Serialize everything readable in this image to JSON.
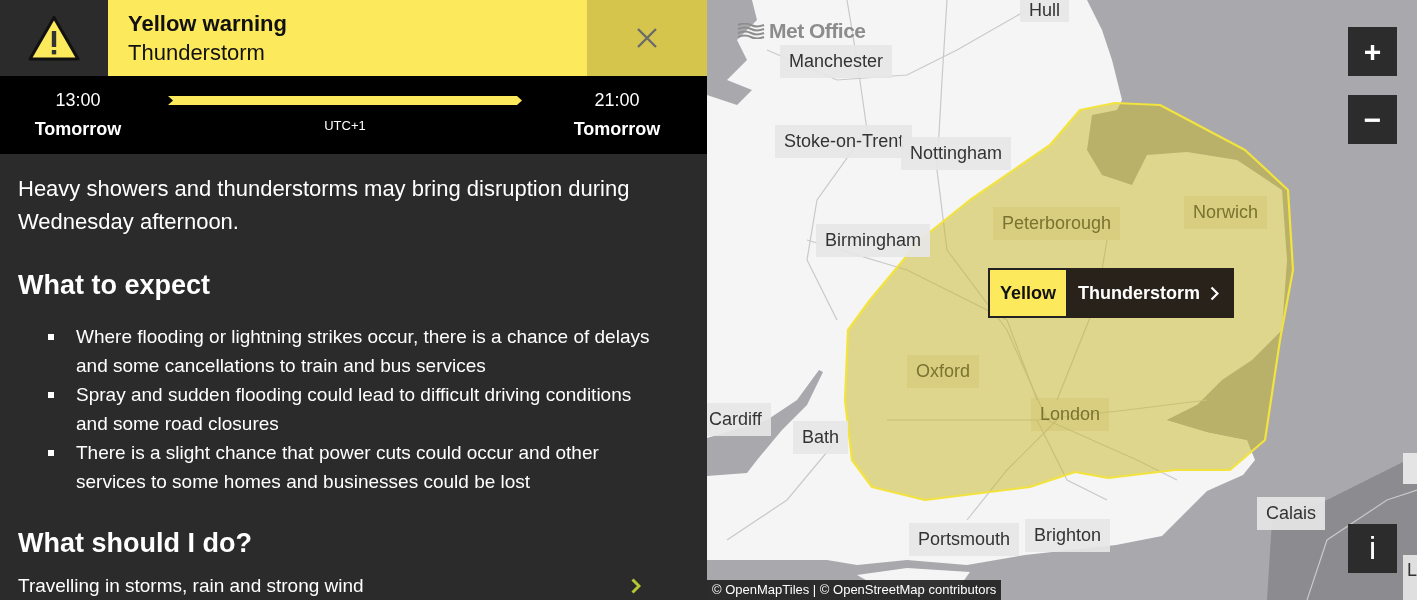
{
  "warning": {
    "title": "Yellow warning",
    "subtitle": "Thunderstorm"
  },
  "timeline": {
    "start_time": "13:00",
    "start_day": "Tomorrow",
    "timezone": "UTC+1",
    "end_time": "21:00",
    "end_day": "Tomorrow"
  },
  "summary": "Heavy showers and thunderstorms may bring disruption during Wednesday afternoon.",
  "what_to_expect": {
    "heading": "What to expect",
    "bullets": [
      "Where flooding or lightning strikes occur, there is a chance of delays and some cancellations to train and bus services",
      "Spray and sudden flooding could lead to difficult driving conditions and some road closures",
      "There is a slight chance that power cuts could occur and other services to some homes and businesses could be lost"
    ]
  },
  "what_to_do": {
    "heading": "What should I do?",
    "links": [
      "Travelling in storms, rain and strong wind"
    ]
  },
  "map": {
    "logo": "Met Office",
    "places": [
      {
        "name": "Hull",
        "inside_warning": false
      },
      {
        "name": "Manchester",
        "inside_warning": false
      },
      {
        "name": "Stoke-on-Trent",
        "inside_warning": false
      },
      {
        "name": "Nottingham",
        "inside_warning": false
      },
      {
        "name": "Norwich",
        "inside_warning": true
      },
      {
        "name": "Peterborough",
        "inside_warning": true
      },
      {
        "name": "Birmingham",
        "inside_warning": false
      },
      {
        "name": "Oxford",
        "inside_warning": true
      },
      {
        "name": "London",
        "inside_warning": true
      },
      {
        "name": "Cardiff",
        "inside_warning": false
      },
      {
        "name": "Bath",
        "inside_warning": false
      },
      {
        "name": "Calais",
        "inside_warning": false
      },
      {
        "name": "Brighton",
        "inside_warning": false
      },
      {
        "name": "Portsmouth",
        "inside_warning": false
      },
      {
        "name": "L",
        "inside_warning": false
      }
    ],
    "warning_chip": {
      "severity": "Yellow",
      "label": "Thunderstorm"
    },
    "zoom_in": "+",
    "zoom_out": "−",
    "info": "i",
    "attribution": "© OpenMapTiles | © OpenStreetMap contributors"
  }
}
